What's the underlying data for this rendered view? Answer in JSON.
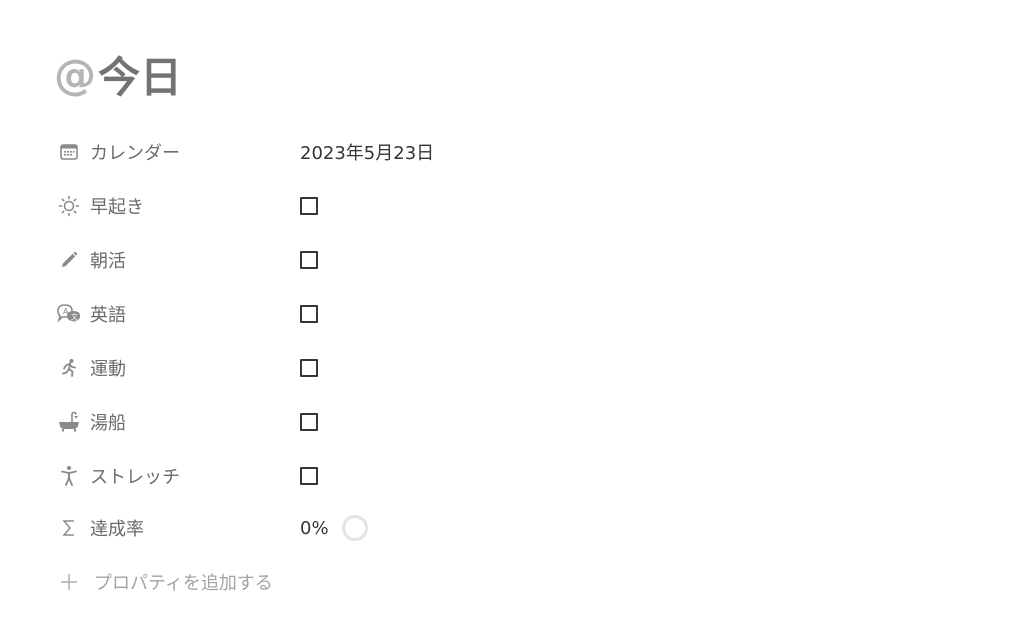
{
  "page": {
    "title_prefix": "@",
    "title": "今日"
  },
  "properties": [
    {
      "icon": "calendar-icon",
      "label": "カレンダー",
      "type": "date",
      "value": "2023年5月23日"
    },
    {
      "icon": "sun-icon",
      "label": "早起き",
      "type": "checkbox",
      "checked": false
    },
    {
      "icon": "pencil-icon",
      "label": "朝活",
      "type": "checkbox",
      "checked": false
    },
    {
      "icon": "chat-bubbles-icon",
      "label": "英語",
      "type": "checkbox",
      "checked": false
    },
    {
      "icon": "running-person-icon",
      "label": "運動",
      "type": "checkbox",
      "checked": false
    },
    {
      "icon": "bathtub-icon",
      "label": "湯船",
      "type": "checkbox",
      "checked": false
    },
    {
      "icon": "stretching-person-icon",
      "label": "ストレッチ",
      "type": "checkbox",
      "checked": false
    },
    {
      "icon": "sigma-icon",
      "label": "達成率",
      "type": "formula",
      "value": "0%",
      "progress": 0
    }
  ],
  "add_property": {
    "icon": "plus-icon",
    "label": "プロパティを追加する"
  },
  "colors": {
    "title": "#737373",
    "title_prefix": "#b5b5b5",
    "label": "#6b6b6b",
    "value": "#37352f",
    "icon": "#8a8a8a",
    "muted": "#a3a3a3",
    "ring": "#e3e3e3"
  }
}
